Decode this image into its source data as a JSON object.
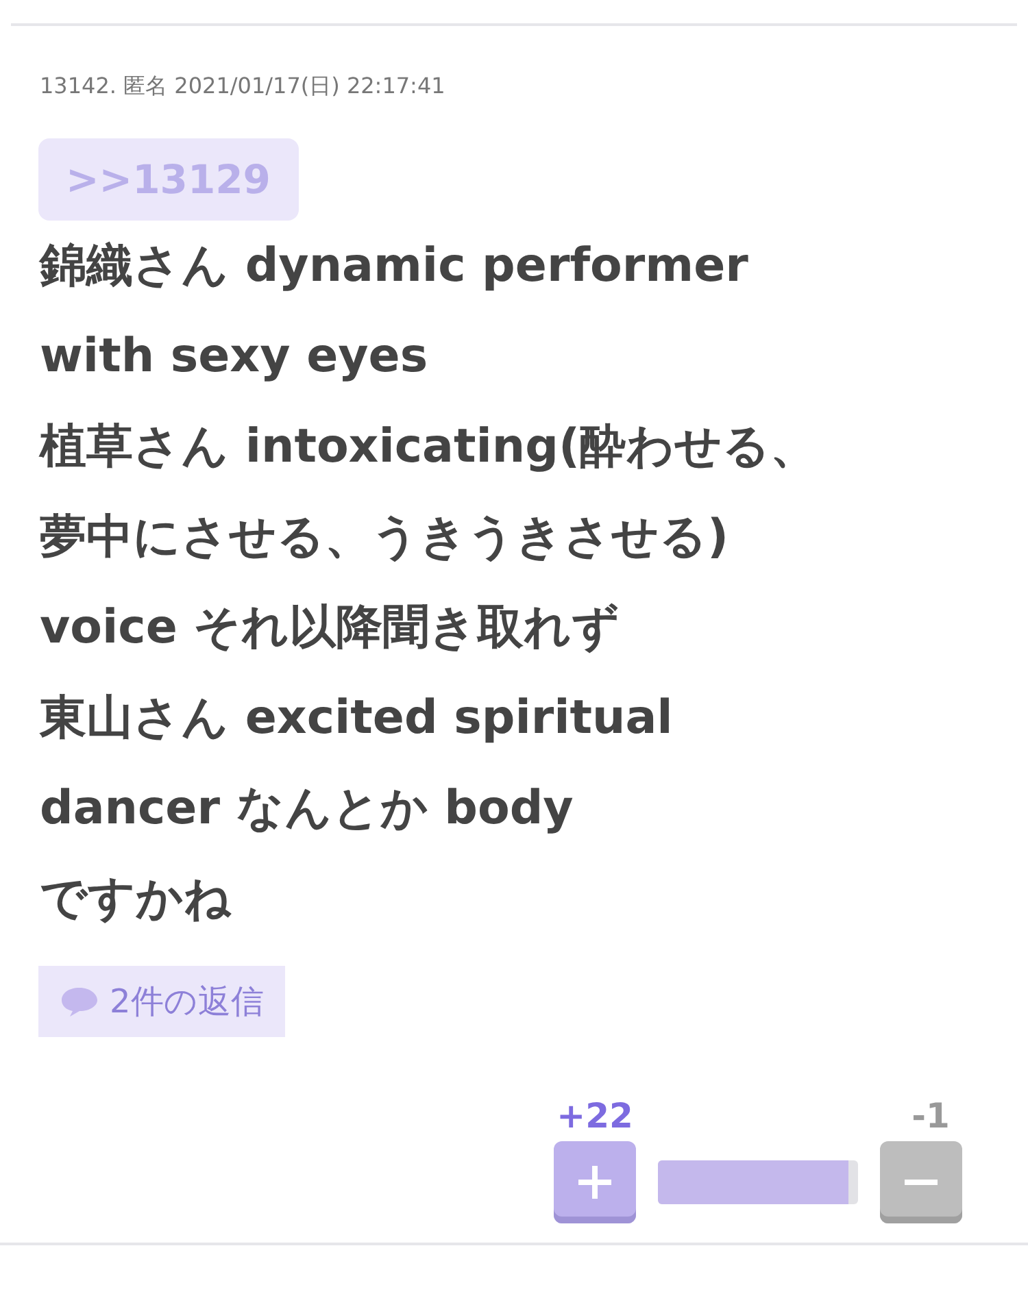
{
  "post": {
    "meta": "13142. 匿名 2021/01/17(日) 22:17:41",
    "quote": ">>13129",
    "body_lines": [
      "錦織さん dynamic performer",
      "with sexy eyes",
      "植草さん intoxicating(酔わせる、",
      "夢中にさせる、うきうきさせる)",
      "voice それ以降聞き取れず",
      "東山さん excited spiritual",
      "dancer なんとか body",
      "ですかね"
    ],
    "replies": "2件の返信",
    "votes": {
      "plus": "+22",
      "minus": "-1",
      "level": 0.95
    }
  }
}
